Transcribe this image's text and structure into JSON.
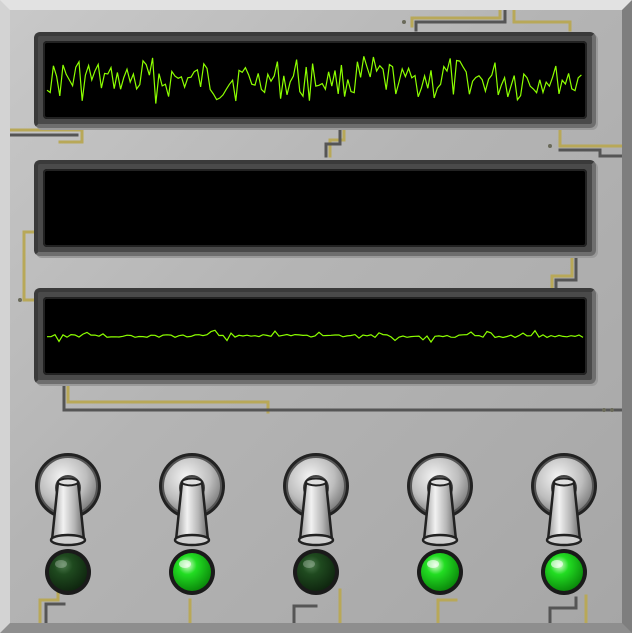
{
  "panel": {
    "colors": {
      "trace": "#8cff00",
      "screen_bg": "#000000",
      "wire": "#b8a858",
      "led_on": "#22dd22",
      "led_off": "#1f4a1f"
    }
  },
  "monitors": [
    {
      "id": "monitor-1",
      "signal": "high-amplitude"
    },
    {
      "id": "monitor-2",
      "signal": "none"
    },
    {
      "id": "monitor-3",
      "signal": "low-amplitude"
    }
  ],
  "switches": [
    {
      "id": "switch-1",
      "state": "off",
      "led_on": false
    },
    {
      "id": "switch-2",
      "state": "on",
      "led_on": true
    },
    {
      "id": "switch-3",
      "state": "off",
      "led_on": false
    },
    {
      "id": "switch-4",
      "state": "on",
      "led_on": true
    },
    {
      "id": "switch-5",
      "state": "on",
      "led_on": true
    }
  ]
}
